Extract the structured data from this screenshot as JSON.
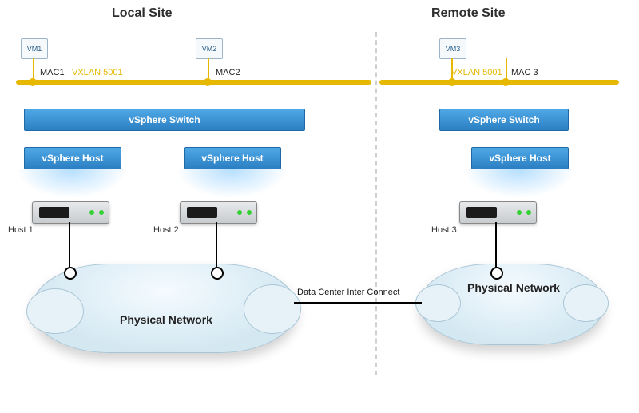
{
  "sites": {
    "local": {
      "title": "Local  Site"
    },
    "remote": {
      "title": "Remote Site"
    }
  },
  "vxlan": {
    "id": "VXLAN 5001",
    "left_label": "VXLAN 5001",
    "right_label": "VXLAN 5001"
  },
  "vms": {
    "vm1": {
      "name": "VM1",
      "mac": "MAC1"
    },
    "vm2": {
      "name": "VM2",
      "mac": "MAC2"
    },
    "vm3": {
      "name": "VM3",
      "mac": "MAC 3"
    }
  },
  "switches": {
    "local": "vSphere Switch",
    "remote": "vSphere Switch"
  },
  "vsphere_hosts": {
    "h1": "vSphere Host",
    "h2": "vSphere Host",
    "h3": "vSphere Host"
  },
  "physical_hosts": {
    "h1": "Host 1",
    "h2": "Host 2",
    "h3": "Host 3"
  },
  "clouds": {
    "local": "Physical  Network",
    "remote": "Physical  Network"
  },
  "interconnect_label": "Data Center Inter Connect",
  "colors": {
    "vxlan_bus": "#e6b800",
    "blue_bar_top": "#4fa8e6",
    "blue_bar_bottom": "#2b7fc2"
  }
}
